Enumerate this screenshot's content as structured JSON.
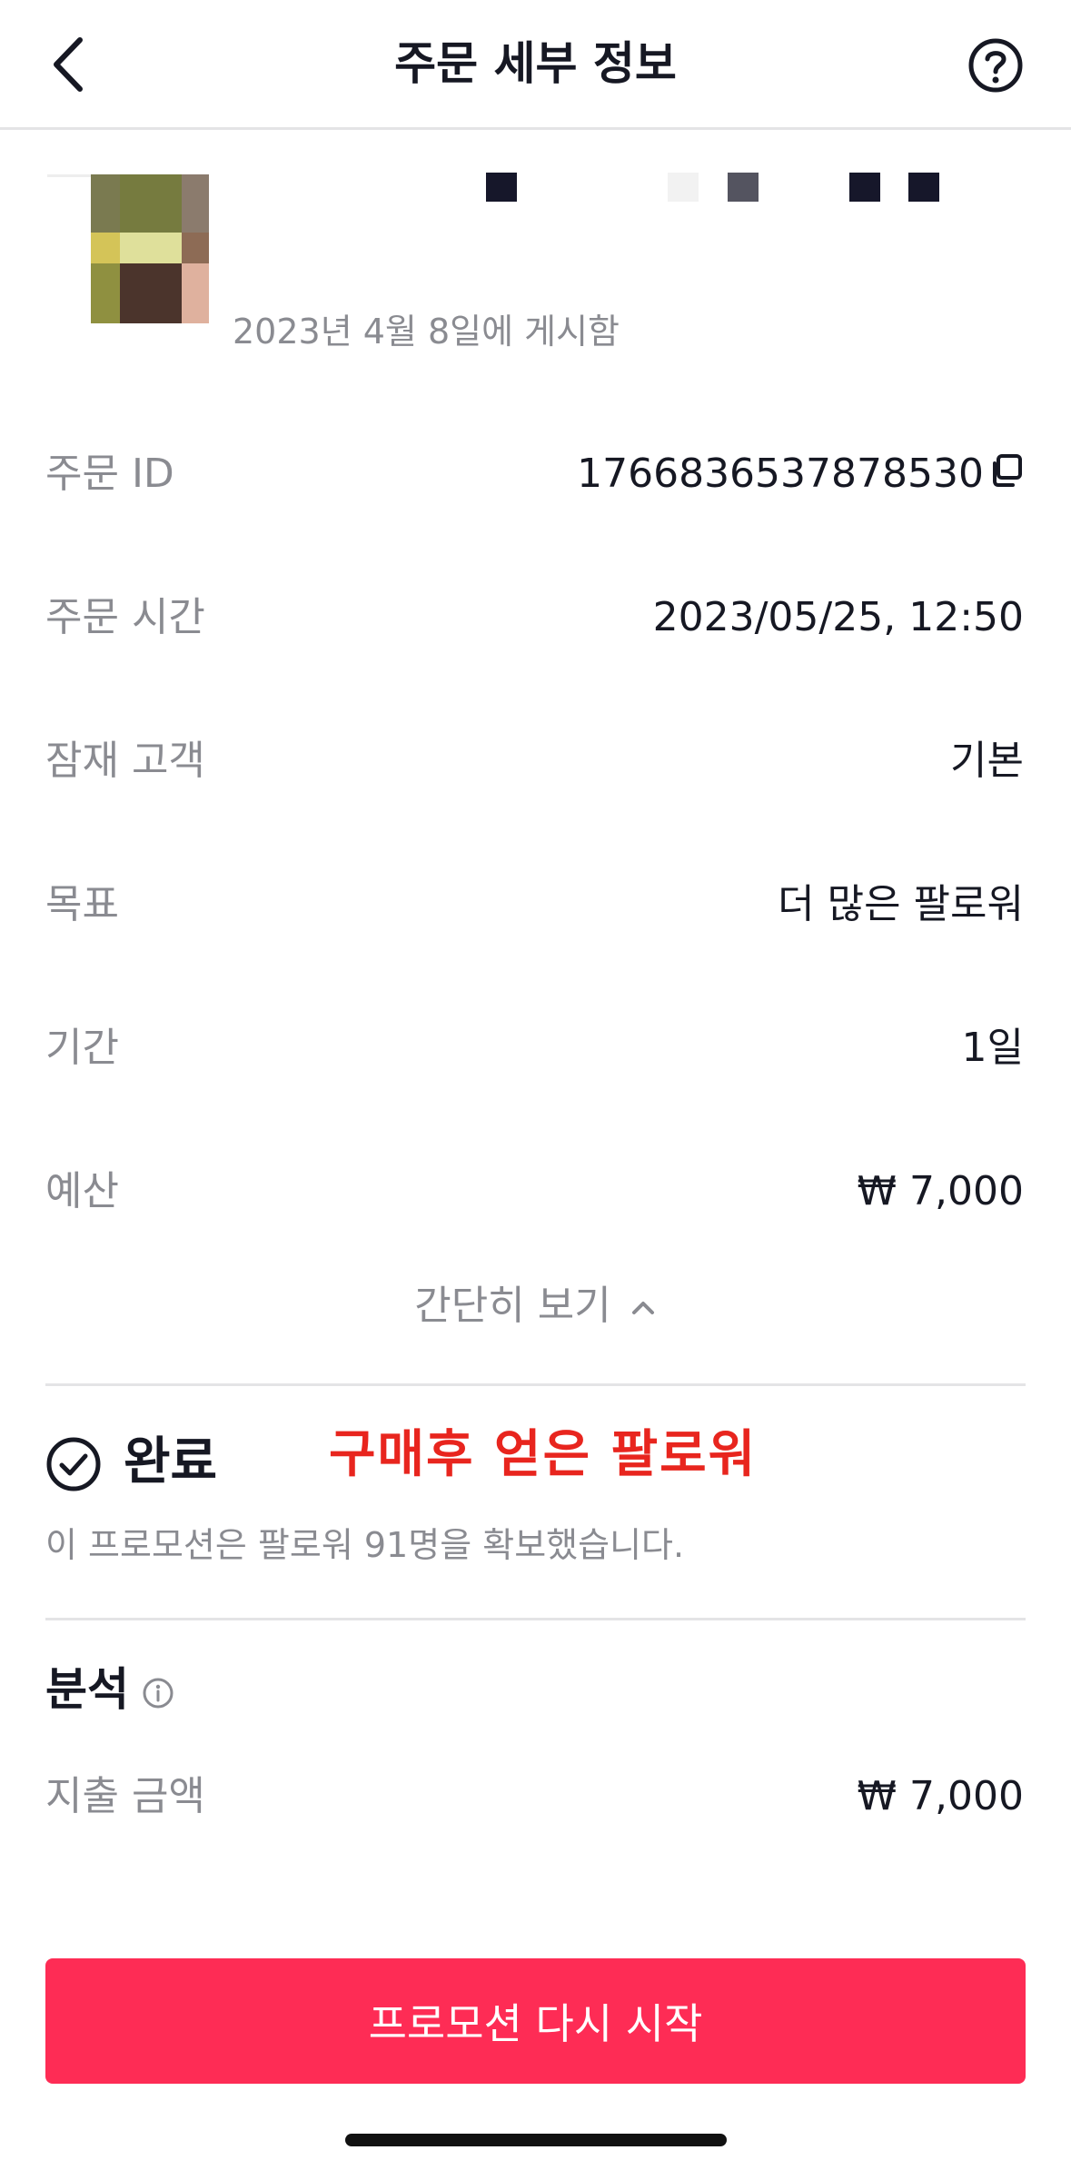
{
  "header": {
    "title": "주문 세부 정보",
    "back_icon": "chevron-left-icon",
    "help_icon": "question-circle-icon"
  },
  "video": {
    "posted_date": "2023년 4월 8일에 게시함"
  },
  "details": [
    {
      "label": "주문 ID",
      "value": "1766836537878530"
    },
    {
      "label": "주문 시간",
      "value": "2023/05/25, 12:50"
    },
    {
      "label": "잠재 고객",
      "value": "기본"
    },
    {
      "label": "목표",
      "value": "더 많은 팔로워"
    },
    {
      "label": "기간",
      "value": "1일"
    },
    {
      "label": "예산",
      "value": "₩ 7,000"
    }
  ],
  "collapse_label": "간단히 보기",
  "status": {
    "label": "완료",
    "annotation": "구매후 얻은 팔로워",
    "description": "이 프로모션은 팔로워 91명을 확보했습니다."
  },
  "analytics": {
    "title": "분석",
    "spend_label": "지출 금액",
    "spend_value": "₩ 7,000"
  },
  "cta": {
    "label": "프로모션 다시 시작"
  },
  "colors": {
    "accent": "#fe2c55",
    "annotation": "#e8251e",
    "text_primary": "#161823",
    "text_secondary": "#8a8b91"
  }
}
